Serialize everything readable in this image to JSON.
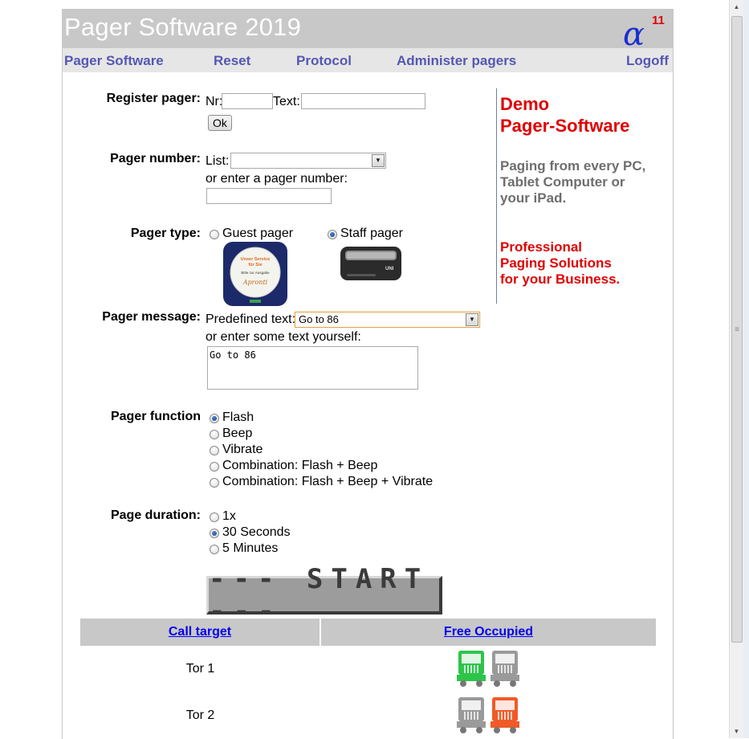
{
  "header": {
    "title": "Pager Software 2019",
    "logo_alpha": "α",
    "logo_sup": "11"
  },
  "nav": {
    "items": [
      "Pager Software",
      "Reset",
      "Protocol",
      "Administer pagers",
      "Logoff"
    ]
  },
  "register": {
    "label": "Register pager:",
    "nr_label": "Nr:",
    "nr_value": "",
    "text_label": "Text:",
    "text_value": "",
    "ok_label": "Ok"
  },
  "pager_number": {
    "label": "Pager number:",
    "list_label": "List:",
    "list_value": "",
    "alt_label": "or enter a pager number:",
    "input_value": ""
  },
  "pager_type": {
    "label": "Pager type:",
    "options": [
      {
        "label": "Guest pager",
        "selected": false
      },
      {
        "label": "Staff pager",
        "selected": true
      }
    ],
    "guest_image_text": [
      "Unser Service",
      "für Sie",
      "Bitte zur Ausgabe",
      "Apronti"
    ],
    "staff_image_text": "UNI"
  },
  "message": {
    "label": "Pager message:",
    "predefined_label": "Predefined text:",
    "predefined_value": "Go to 86",
    "alt_label": "or enter some text yourself:",
    "text_value": "Go to 86"
  },
  "function": {
    "label": "Pager function",
    "options": [
      {
        "label": "Flash",
        "selected": true
      },
      {
        "label": "Beep",
        "selected": false
      },
      {
        "label": "Vibrate",
        "selected": false
      },
      {
        "label": "Combination: Flash + Beep",
        "selected": false
      },
      {
        "label": "Combination: Flash + Beep + Vibrate",
        "selected": false
      }
    ]
  },
  "duration": {
    "label": "Page duration:",
    "options": [
      {
        "label": "1x",
        "selected": false
      },
      {
        "label": "30 Seconds",
        "selected": true
      },
      {
        "label": "5 Minutes",
        "selected": false
      }
    ]
  },
  "start_label": "--- START ---",
  "sidebar": {
    "demo_line1": "Demo",
    "demo_line2": "Pager-Software",
    "paging_line1": "Paging from every PC,",
    "paging_line2": "Tablet Computer or",
    "paging_line3": "your iPad.",
    "pro_line1": "Professional",
    "pro_line2": "Paging Solutions",
    "pro_line3": "for your Business."
  },
  "targets": {
    "col_target": "Call target",
    "col_status": "Free Occupied",
    "rows": [
      {
        "name": "Tor 1",
        "free": true,
        "occupied": false
      },
      {
        "name": "Tor 2",
        "free": false,
        "occupied": true
      }
    ]
  },
  "colors": {
    "nav_text": "#5557b3",
    "promo_red": "#e00000",
    "free_green": "#2ec44a",
    "occupied_orange": "#f05a28",
    "inactive_gray": "#9a9a9a"
  }
}
